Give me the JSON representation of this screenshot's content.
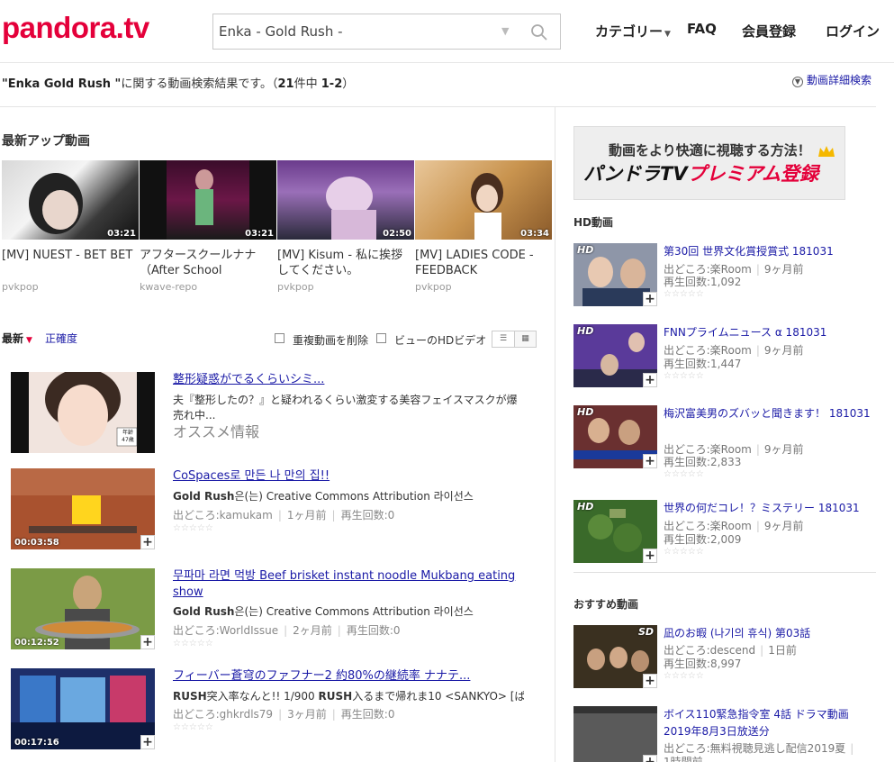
{
  "header": {
    "logo": "pandora.tv",
    "search_value": "Enka - Gold Rush -",
    "nav": {
      "category": "カテゴリー",
      "faq": "FAQ",
      "register": "会員登録",
      "login": "ログイン"
    }
  },
  "results_info": {
    "query": "\"Enka Gold Rush \"",
    "suffix": "に関する動画検索結果です。（",
    "total": "21",
    "mid": "件中 ",
    "range": "1-2",
    "close": "）",
    "advanced": "動画詳細検索"
  },
  "latest": {
    "title": "最新アップ動画",
    "items": [
      {
        "title": "[MV] NUEST - BET BET",
        "channel": "pvkpop",
        "duration": "03:21"
      },
      {
        "title": "アフタースクールナナ（After School",
        "channel": "kwave-repo",
        "duration": "03:21"
      },
      {
        "title": "[MV] Kisum - 私に挨拶してください。",
        "channel": "pvkpop",
        "duration": "02:50"
      },
      {
        "title": "[MV] LADIES CODE - FEEDBACK",
        "channel": "pvkpop",
        "duration": "03:34"
      }
    ]
  },
  "sortbar": {
    "latest": "最新",
    "accuracy": "正確度",
    "dedupe": "重複動画を削除",
    "hd": "ビューのHDビデオ"
  },
  "results": [
    {
      "title": "整形疑惑がでるくらいシミ...",
      "desc": "夫『整形したの？』と疑われるくらい激変する美容フェイスマスクが爆売れ中...",
      "badge": "オススメ情報",
      "thumb_label": "年齢 47歳"
    },
    {
      "title": "CoSpaces로 만든 나 만의 집!!",
      "desc_bold": "Gold Rush",
      "desc_rest": "은(는) Creative Commons Attribution 라이선스",
      "source": "出どころ:kamukam",
      "age": "1ヶ月前",
      "views": "再生回数:0",
      "duration": "00:03:58"
    },
    {
      "title": "무파마 라면 먹방 Beef brisket instant noodle Mukbang eating show",
      "desc_bold": "Gold Rush",
      "desc_rest": "은(는) Creative Commons Attribution 라이선스",
      "source": "出どころ:WorldIssue",
      "age": "2ヶ月前",
      "views": "再生回数:0",
      "duration": "00:12:52"
    },
    {
      "title": "フィーバー蒼穹のファフナー2 約80%の継続率 ナナテ...",
      "desc_bold": "RUSH",
      "desc_rest": "突入率なんと!! 1/900 ",
      "desc_bold2": "RUSH",
      "desc_rest2": "入るまで帰れま10 <SANKYO> [ぱ",
      "source": "出どころ:ghkrdls79",
      "age": "3ヶ月前",
      "views": "再生回数:0",
      "duration": "00:17:16"
    }
  ],
  "sidebar": {
    "banner_line1": "動画をより快適に視聴する方法！",
    "banner_line2a": "パンドラTV",
    "banner_line2b": "プレミアム登録",
    "hd_title": "HD動画",
    "hd_items": [
      {
        "title": "第30回 世界文化賞授賞式 181031",
        "source": "出どころ:楽Room",
        "age": "9ヶ月前",
        "views": "再生回数:1,092"
      },
      {
        "title": "FNNプライムニュース α 181031",
        "source": "出どころ:楽Room",
        "age": "9ヶ月前",
        "views": "再生回数:1,447"
      },
      {
        "title": "梅沢富美男のズバッと聞きます！ 181031",
        "source": "出どころ:楽Room",
        "age": "9ヶ月前",
        "views": "再生回数:2,833"
      },
      {
        "title": "世界の何だコレ！？ミステリー 181031",
        "source": "出どころ:楽Room",
        "age": "9ヶ月前",
        "views": "再生回数:2,009"
      }
    ],
    "hd_tag": "HD",
    "rec_title": "おすすめ動画",
    "rec_items": [
      {
        "title": "凪のお暇 (나기의 휴식) 第03話",
        "source": "出どころ:descend",
        "age": "1日前",
        "views": "再生回数:8,997",
        "tag": "SD"
      },
      {
        "title": "ボイス110緊急指令室 4話 ドラマ動画 2019年8月3日放送分",
        "source": "出どころ:無料視聴見逃し配信2019夏",
        "age": "1時間前"
      }
    ]
  },
  "stars": "☆☆☆☆☆",
  "colors": {
    "brand": "#e4003a",
    "link": "#1a1aa6"
  }
}
